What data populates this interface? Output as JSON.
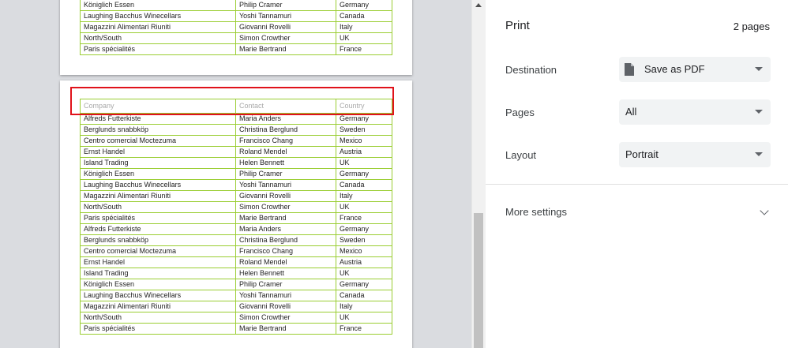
{
  "preview": {
    "page1_rows": [
      [
        "Königlich Essen",
        "Philip Cramer",
        "Germany"
      ],
      [
        "Laughing Bacchus Winecellars",
        "Yoshi Tannamuri",
        "Canada"
      ],
      [
        "Magazzini Alimentari Riuniti",
        "Giovanni Rovelli",
        "Italy"
      ],
      [
        "North/South",
        "Simon Crowther",
        "UK"
      ],
      [
        "Paris spécialités",
        "Marie Bertrand",
        "France"
      ]
    ],
    "headers": [
      "Company",
      "Contact",
      "Country"
    ],
    "page2_rows": [
      [
        "Alfreds Futterkiste",
        "Maria Anders",
        "Germany"
      ],
      [
        "Berglunds snabbköp",
        "Christina Berglund",
        "Sweden"
      ],
      [
        "Centro comercial Moctezuma",
        "Francisco Chang",
        "Mexico"
      ],
      [
        "Ernst Handel",
        "Roland Mendel",
        "Austria"
      ],
      [
        "Island Trading",
        "Helen Bennett",
        "UK"
      ],
      [
        "Königlich Essen",
        "Philip Cramer",
        "Germany"
      ],
      [
        "Laughing Bacchus Winecellars",
        "Yoshi Tannamuri",
        "Canada"
      ],
      [
        "Magazzini Alimentari Riuniti",
        "Giovanni Rovelli",
        "Italy"
      ],
      [
        "North/South",
        "Simon Crowther",
        "UK"
      ],
      [
        "Paris spécialités",
        "Marie Bertrand",
        "France"
      ],
      [
        "Alfreds Futterkiste",
        "Maria Anders",
        "Germany"
      ],
      [
        "Berglunds snabbköp",
        "Christina Berglund",
        "Sweden"
      ],
      [
        "Centro comercial Moctezuma",
        "Francisco Chang",
        "Mexico"
      ],
      [
        "Ernst Handel",
        "Roland Mendel",
        "Austria"
      ],
      [
        "Island Trading",
        "Helen Bennett",
        "UK"
      ],
      [
        "Königlich Essen",
        "Philip Cramer",
        "Germany"
      ],
      [
        "Laughing Bacchus Winecellars",
        "Yoshi Tannamuri",
        "Canada"
      ],
      [
        "Magazzini Alimentari Riuniti",
        "Giovanni Rovelli",
        "Italy"
      ],
      [
        "North/South",
        "Simon Crowther",
        "UK"
      ],
      [
        "Paris spécialités",
        "Marie Bertrand",
        "France"
      ]
    ]
  },
  "print_panel": {
    "title": "Print",
    "pages_count": "2 pages",
    "destination_label": "Destination",
    "destination_value": "Save as PDF",
    "destination_icon": "document-icon",
    "pages_label": "Pages",
    "pages_value": "All",
    "layout_label": "Layout",
    "layout_value": "Portrait",
    "more_settings": "More settings"
  },
  "colors": {
    "table_border": "#9acd32",
    "highlight": "#e0121a",
    "header_text": "#a9a9a9"
  }
}
